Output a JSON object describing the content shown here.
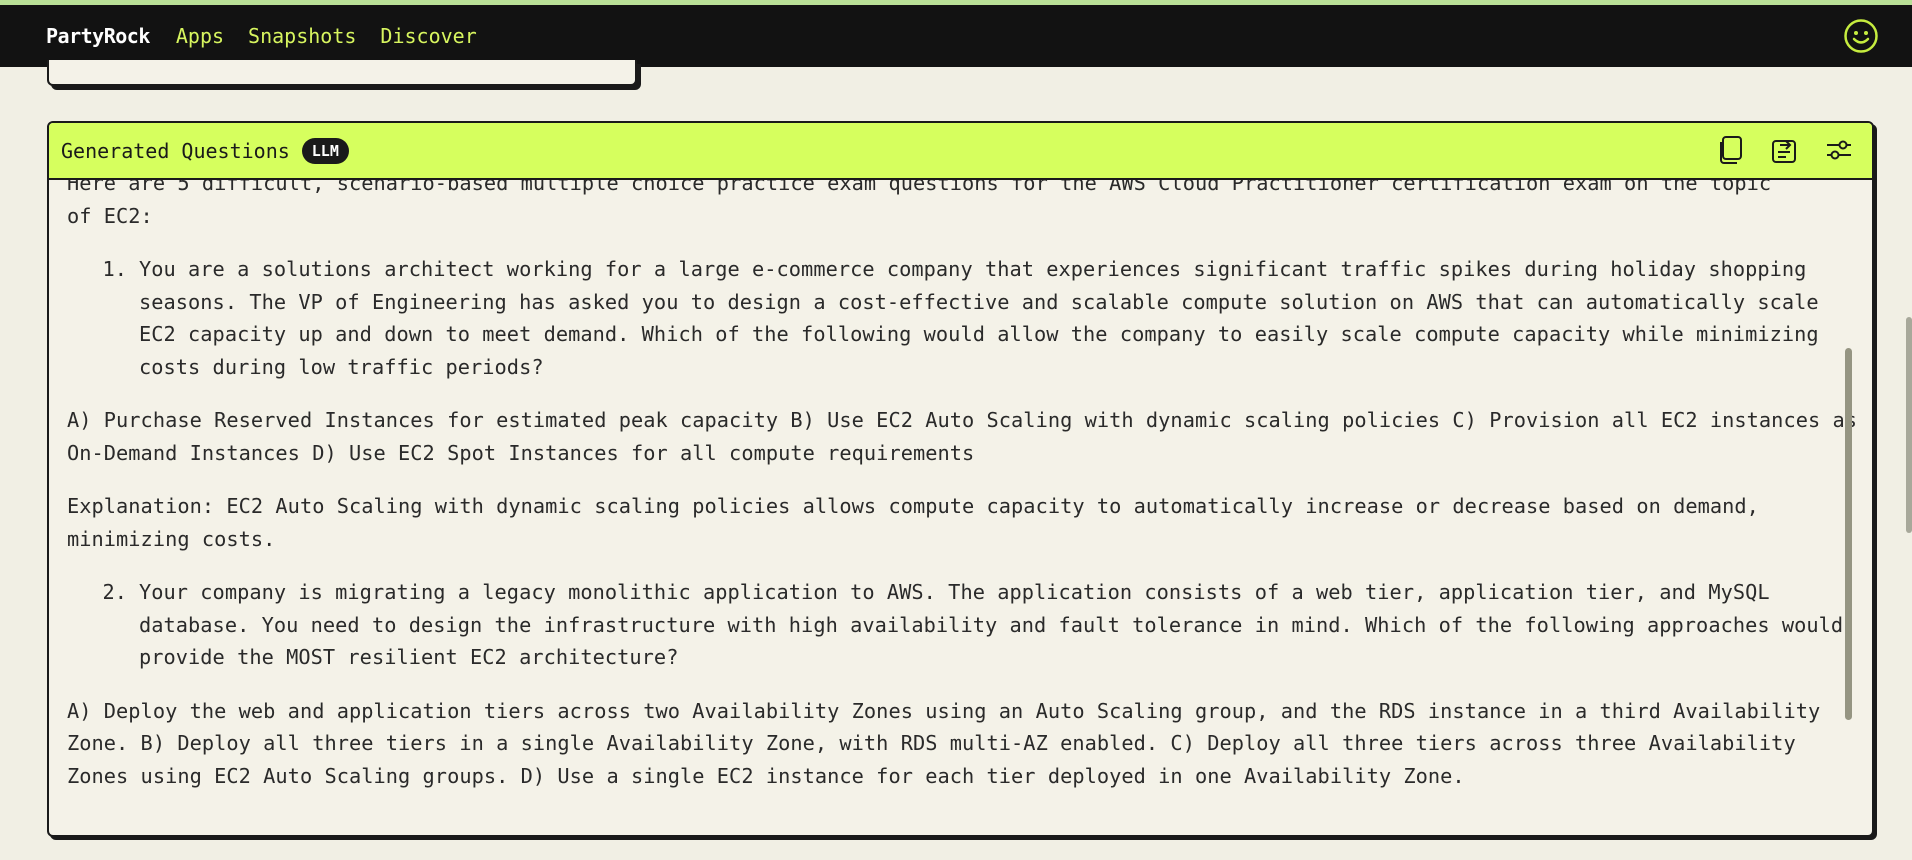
{
  "nav": {
    "brand": "PartyRock",
    "links": [
      "Apps",
      "Snapshots",
      "Discover"
    ],
    "avatar_icon": "smiley-face-icon"
  },
  "card": {
    "title": "Generated Questions",
    "badge": "LLM",
    "actions": [
      "copy-icon",
      "export-icon",
      "settings-sliders-icon"
    ],
    "intro_clipped": "Here are 5 difficult, scenario-based multiple choice practice exam questions for the AWS Cloud Practitioner certification exam on the topic",
    "intro_end": "of EC2:",
    "q1_num": "1.",
    "q1_text": "You are a solutions architect working for a large e-commerce company that experiences significant traffic spikes during holiday shopping seasons. The VP of Engineering has asked you to design a cost-effective and scalable compute solution on AWS that can automatically scale EC2 capacity up and down to meet demand. Which of the following would allow the company to easily scale compute capacity while minimizing costs during low traffic periods?",
    "q1_options": "A) Purchase Reserved Instances for estimated peak capacity B) Use EC2 Auto Scaling with dynamic scaling policies C) Provision all EC2 instances as On-Demand Instances D) Use EC2 Spot Instances for all compute requirements",
    "q1_explanation": "Explanation: EC2 Auto Scaling with dynamic scaling policies allows compute capacity to automatically increase or decrease based on demand, minimizing costs.",
    "q2_num": "2.",
    "q2_text": "Your company is migrating a legacy monolithic application to AWS. The application consists of a web tier, application tier, and MySQL database. You need to design the infrastructure with high availability and fault tolerance in mind. Which of the following approaches would provide the MOST resilient EC2 architecture?",
    "q2_options": "A) Deploy the web and application tiers across two Availability Zones using an Auto Scaling group, and the RDS instance in a third Availability Zone. B) Deploy all three tiers in a single Availability Zone, with RDS multi-AZ enabled. C) Deploy all three tiers across three Availability Zones using EC2 Auto Scaling groups. D) Use a single EC2 instance for each tier deployed in one Availability Zone."
  }
}
